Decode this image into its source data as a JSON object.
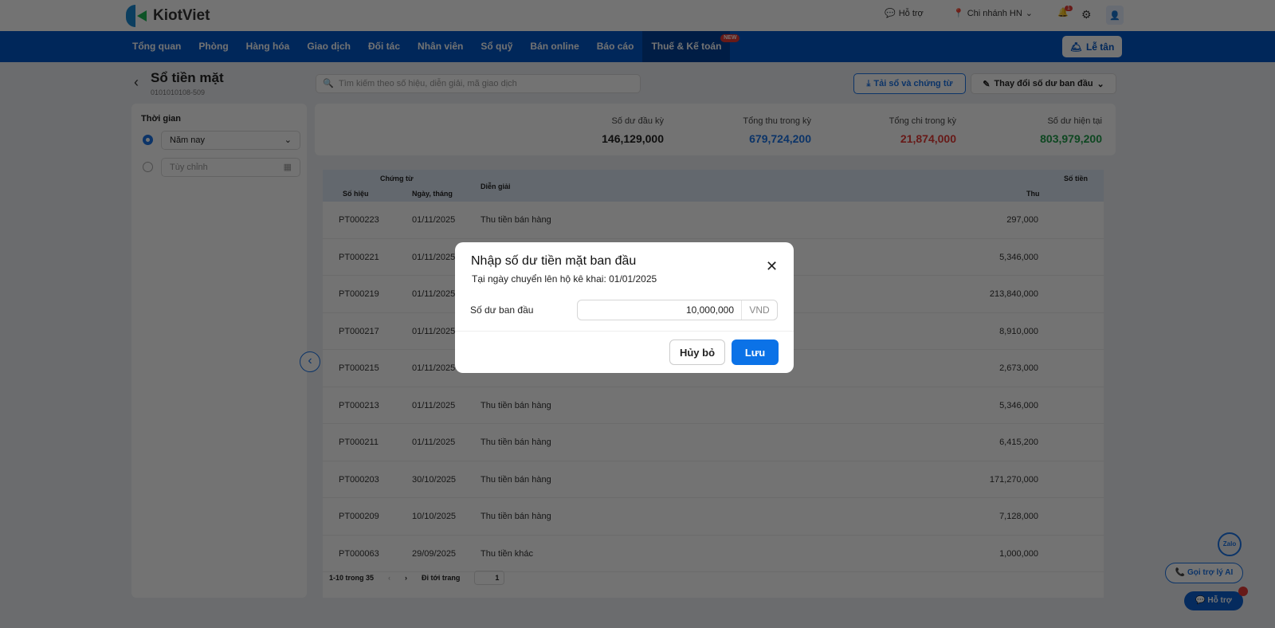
{
  "brand": "KiotViet",
  "header": {
    "support": "Hỗ trợ",
    "branch": "Chi nhánh HN",
    "notif_count": "1"
  },
  "nav": [
    "Tổng quan",
    "Phòng",
    "Hàng hóa",
    "Giao dịch",
    "Đối tác",
    "Nhân viên",
    "Sổ quỹ",
    "Bán online",
    "Báo cáo",
    "Thuế & Kế toán"
  ],
  "nav_new_badge": "NEW",
  "reception": "Lễ tân",
  "page": {
    "title": "Sổ tiền mặt",
    "subtitle": "0101010108-509",
    "search_placeholder": "Tìm kiếm theo số hiệu, diễn giải, mã giao dịch",
    "download": "Tải sổ và chứng từ",
    "change_balance": "Thay đổi số dư ban đầu"
  },
  "filter": {
    "title": "Thời gian",
    "option1": "Năm nay",
    "option2_placeholder": "Tùy chỉnh"
  },
  "summary": [
    {
      "label": "Số dư đầu kỳ",
      "value": "146,129,000",
      "color": "#222222"
    },
    {
      "label": "Tổng thu trong kỳ",
      "value": "679,724,200",
      "color": "#1a73e8"
    },
    {
      "label": "Tổng chi trong kỳ",
      "value": "21,874,000",
      "color": "#e53935"
    },
    {
      "label": "Số dư hiện tại",
      "value": "803,979,200",
      "color": "#1e9e4a"
    }
  ],
  "table": {
    "headers": {
      "group": "Chứng từ",
      "code": "Số hiệu",
      "date": "Ngày, tháng",
      "desc": "Diễn giải",
      "income": "Thu",
      "amount_group": "Số tiền"
    },
    "rows": [
      [
        "PT000223",
        "01/11/2025",
        "Thu tiền bán hàng",
        "297,000"
      ],
      [
        "PT000221",
        "01/11/2025",
        "",
        "5,346,000"
      ],
      [
        "PT000219",
        "01/11/2025",
        "",
        "213,840,000"
      ],
      [
        "PT000217",
        "01/11/2025",
        "",
        "8,910,000"
      ],
      [
        "PT000215",
        "01/11/2025",
        "",
        "2,673,000"
      ],
      [
        "PT000213",
        "01/11/2025",
        "Thu tiền bán hàng",
        "5,346,000"
      ],
      [
        "PT000211",
        "01/11/2025",
        "Thu tiền bán hàng",
        "6,415,200"
      ],
      [
        "PT000203",
        "30/10/2025",
        "Thu tiền bán hàng",
        "171,270,000"
      ],
      [
        "PT000209",
        "10/10/2025",
        "Thu tiền bán hàng",
        "7,128,000"
      ],
      [
        "PT000063",
        "29/09/2025",
        "Thu tiền khác",
        "1,000,000"
      ]
    ],
    "pagination": {
      "range": "1-10 trong 35",
      "goto": "Đi tới trang",
      "page": "1"
    }
  },
  "floating": {
    "zalo": "Zalo",
    "ai_call": "Gọi trợ lý AI",
    "help": "Hỗ trợ"
  },
  "modal": {
    "title": "Nhập số dư tiền mặt ban đầu",
    "subtitle": "Tại ngày chuyển lên hộ kê khai: 01/01/2025",
    "field_label": "Số dư ban đầu",
    "field_value": "10,000,000",
    "unit": "VND",
    "cancel": "Hủy bỏ",
    "save": "Lưu"
  }
}
